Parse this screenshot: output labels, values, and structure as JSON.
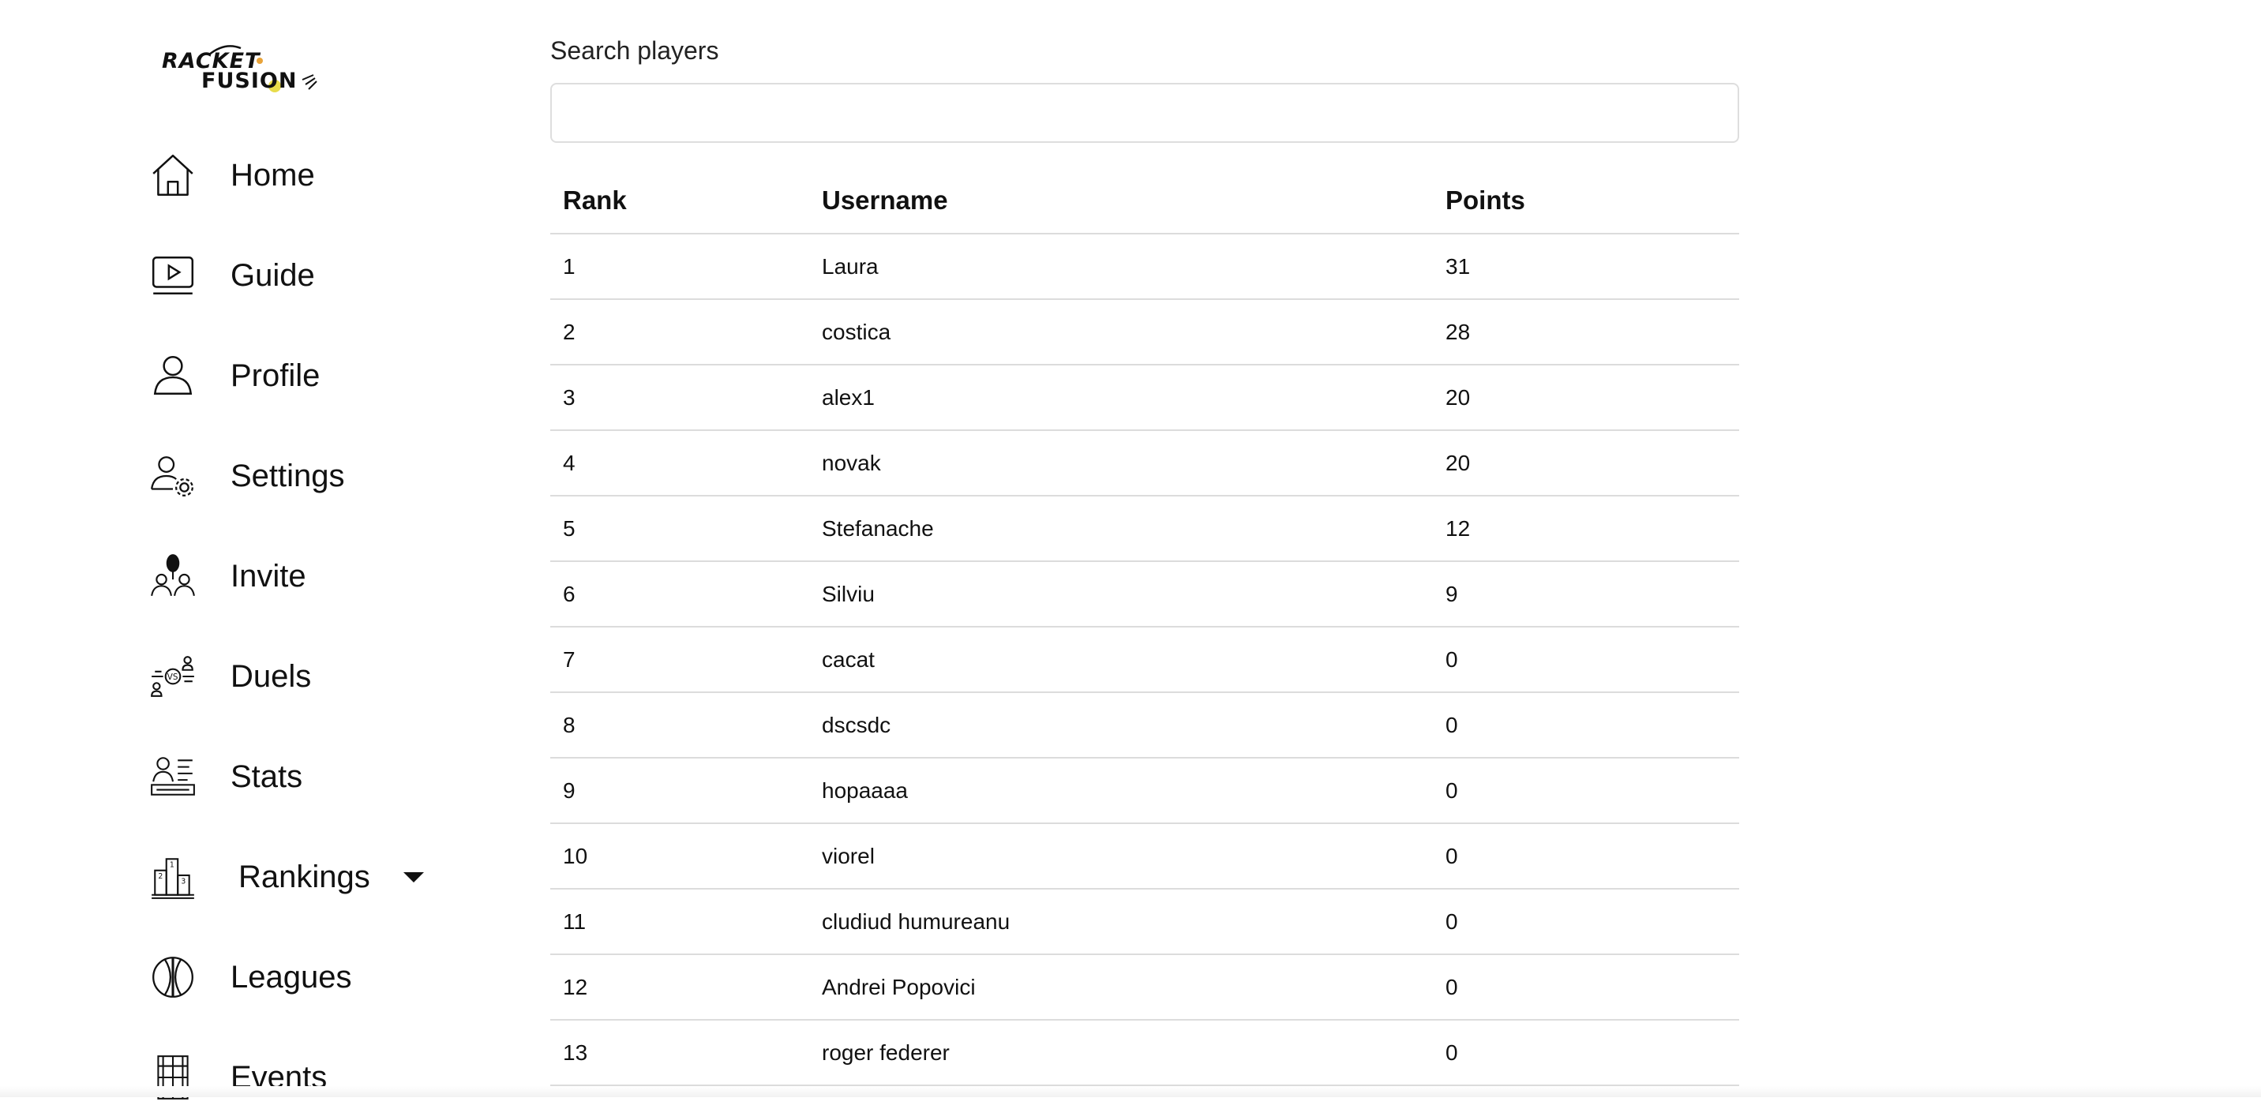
{
  "brand": {
    "line1": "RACKET",
    "line2": "FUSION"
  },
  "nav": [
    {
      "label": "Home",
      "icon": "home-icon"
    },
    {
      "label": "Guide",
      "icon": "video-guide-icon"
    },
    {
      "label": "Profile",
      "icon": "user-icon"
    },
    {
      "label": "Settings",
      "icon": "user-settings-icon"
    },
    {
      "label": "Invite",
      "icon": "invite-players-icon"
    },
    {
      "label": "Duels",
      "icon": "versus-icon"
    },
    {
      "label": "Stats",
      "icon": "stats-icon"
    },
    {
      "label": "Rankings",
      "icon": "podium-icon"
    },
    {
      "label": "Leagues",
      "icon": "league-ball-icon"
    },
    {
      "label": "Events",
      "icon": "court-icon"
    }
  ],
  "search": {
    "label": "Search players",
    "value": "",
    "placeholder": ""
  },
  "table": {
    "headers": [
      "Rank",
      "Username",
      "Points"
    ],
    "rows": [
      [
        "1",
        "Laura",
        "31"
      ],
      [
        "2",
        "costica",
        "28"
      ],
      [
        "3",
        "alex1",
        "20"
      ],
      [
        "4",
        "novak",
        "20"
      ],
      [
        "5",
        "Stefanache",
        "12"
      ],
      [
        "6",
        "Silviu",
        "9"
      ],
      [
        "7",
        "cacat",
        "0"
      ],
      [
        "8",
        "dscsdc",
        "0"
      ],
      [
        "9",
        "hopaaaa",
        "0"
      ],
      [
        "10",
        "viorel",
        "0"
      ],
      [
        "11",
        "cludiud humureanu",
        "0"
      ],
      [
        "12",
        "Andrei Popovici",
        "0"
      ],
      [
        "13",
        "roger federer",
        "0"
      ]
    ]
  },
  "colors": {
    "text": "#111111",
    "border": "#dcdcdc",
    "logo_accent": "#e8a33a"
  }
}
